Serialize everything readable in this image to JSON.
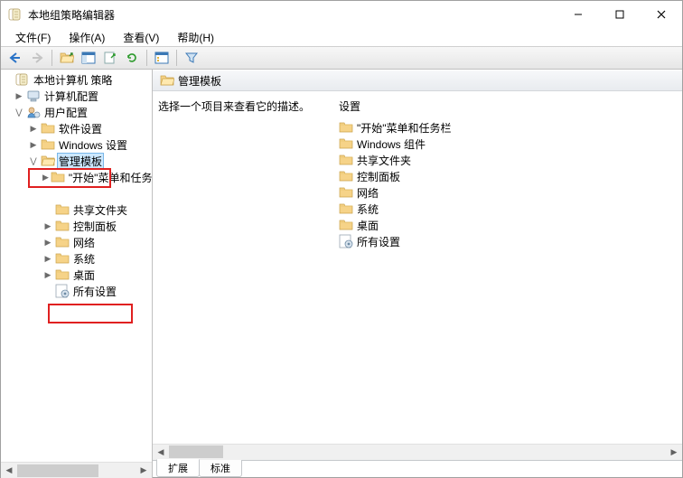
{
  "window": {
    "title": "本地组策略编辑器"
  },
  "menubar": {
    "file": "文件(F)",
    "action": "操作(A)",
    "view": "查看(V)",
    "help": "帮助(H)"
  },
  "tree": {
    "root": "本地计算机 策略",
    "computer_config": "计算机配置",
    "user_config": "用户配置",
    "software_settings": "软件设置",
    "windows_settings": "Windows 设置",
    "admin_templates": "管理模板",
    "start_taskbar": "\"开始\"菜单和任务栏",
    "shared_folders": "共享文件夹",
    "control_panel": "控制面板",
    "network": "网络",
    "system": "系统",
    "desktop": "桌面",
    "all_settings": "所有设置"
  },
  "content": {
    "header": "管理模板",
    "description": "选择一个项目来查看它的描述。",
    "list_header": "设置",
    "items": {
      "start_taskbar": "\"开始\"菜单和任务栏",
      "windows_components": "Windows 组件",
      "shared_folders": "共享文件夹",
      "control_panel": "控制面板",
      "network": "网络",
      "system": "系统",
      "desktop": "桌面",
      "all_settings": "所有设置"
    }
  },
  "tabs": {
    "extended": "扩展",
    "standard": "标准"
  }
}
